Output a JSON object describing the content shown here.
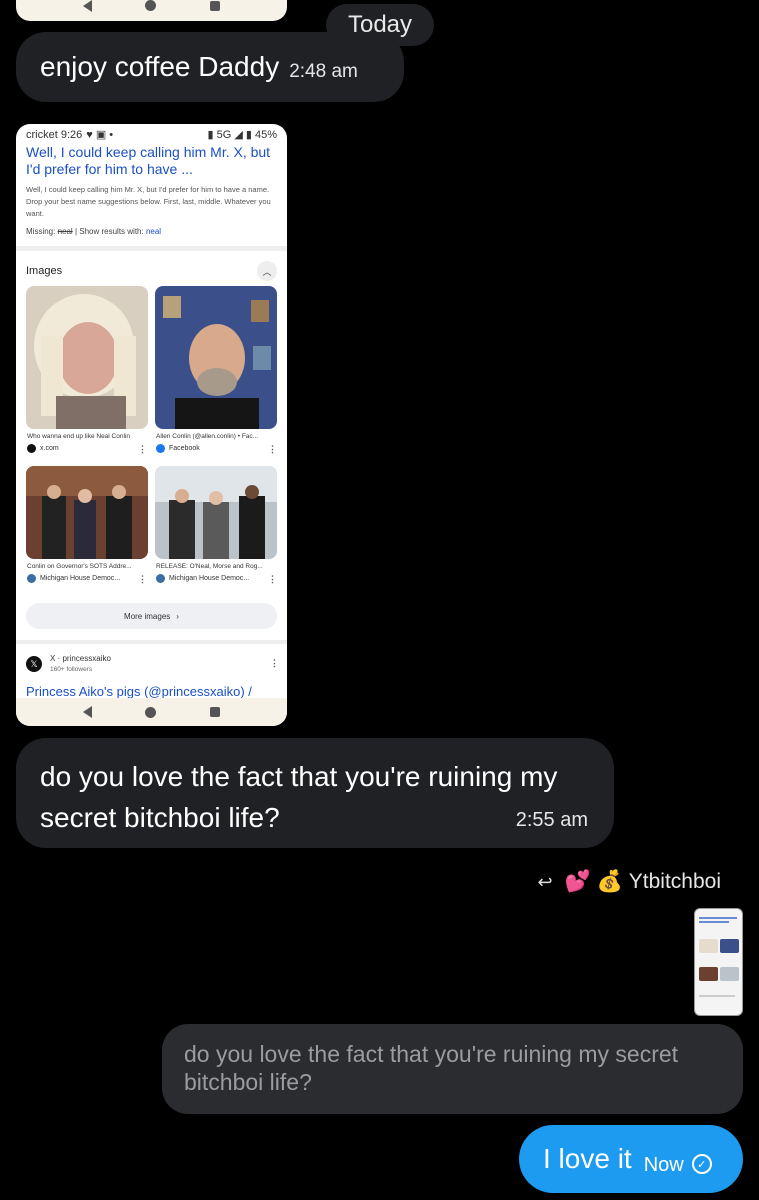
{
  "day_separator": "Today",
  "messages": [
    {
      "text": "enjoy coffee Daddy",
      "time": "2:48 am"
    },
    {
      "text": "do you love the fact that you're ruining my secret bitchboi life?",
      "time": "2:55 am"
    }
  ],
  "shared_screenshot": {
    "status": {
      "carrier": "cricket 9:26",
      "battery": "45%"
    },
    "result_title": "Well, I could keep calling him Mr. X, but I'd prefer for him to have ...",
    "result_snippet": "Well, I could keep calling him Mr. X, but I'd prefer for him to have a name. Drop your best name suggestions below. First, last, middle. Whatever you want.",
    "missing_label": "Missing:",
    "missing_word": "neal",
    "show_results_label": "| Show results with:",
    "show_results_link": "neal",
    "images_heading": "Images",
    "images": [
      {
        "caption": "Who wanna end up like Neal Conlin",
        "source": "x.com"
      },
      {
        "caption": "Allen Conlin (@allen.conlin) • Fac...",
        "source": "Facebook"
      },
      {
        "caption": "Conlin on Governor's SOTS Addre...",
        "source": "Michigan House Democ..."
      },
      {
        "caption": "RELEASE: O'Neal, Morse and Rog...",
        "source": "Michigan House Democ..."
      }
    ],
    "more_images_label": "More images",
    "x_result": {
      "site": "X · princessxaiko",
      "followers": "160+ followers",
      "title": "Princess Aiko's pigs (@princessxaiko) /"
    }
  },
  "reply_header": {
    "emojis": "💕 💰",
    "name": "Ytbitchboi"
  },
  "quoted_text": "do you love the fact that you're ruining my secret bitchboi life?",
  "outgoing": {
    "text": "I love it",
    "time": "Now"
  }
}
